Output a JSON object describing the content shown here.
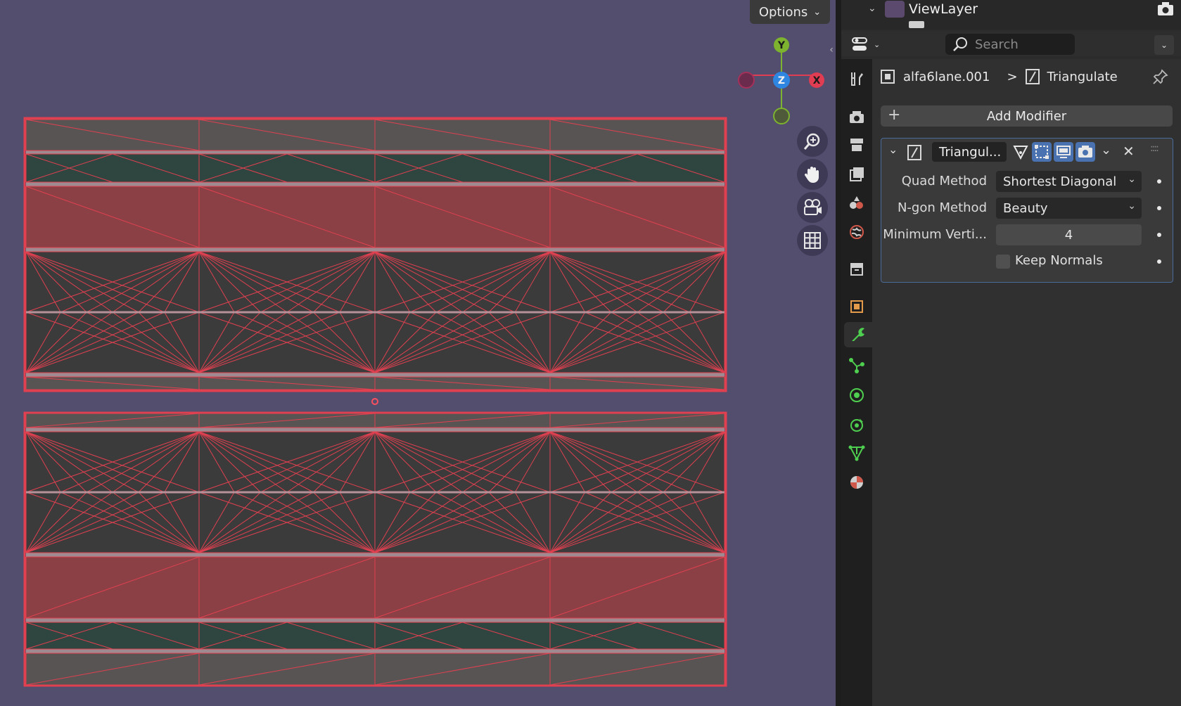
{
  "viewport": {
    "options_label": "Options",
    "gizmo": {
      "y_label": "Y",
      "z_label": "Z",
      "x_label": "X"
    }
  },
  "outliner": {
    "view_layer_label": "ViewLayer"
  },
  "properties": {
    "search_placeholder": "Search",
    "breadcrumb": {
      "object": "alfa6lane.001",
      "separator": ">",
      "modifier": "Triangulate"
    },
    "add_modifier_label": "Add Modifier",
    "modifier": {
      "name": "Triangul...",
      "quad_method_label": "Quad Method",
      "quad_method_value": "Shortest Diagonal",
      "ngon_method_label": "N-gon Method",
      "ngon_method_value": "Beauty",
      "min_vertices_label": "Minimum Verti...",
      "min_vertices_value": "4",
      "keep_normals_label": "Keep Normals"
    }
  },
  "colors": {
    "viewport_bg": "#534d6e",
    "edge_red": "#e04050",
    "active_tab_green": "#4fcf4f",
    "gizmo_x": "#e03c52",
    "gizmo_y": "#7db32e",
    "gizmo_z": "#2f86e0"
  }
}
